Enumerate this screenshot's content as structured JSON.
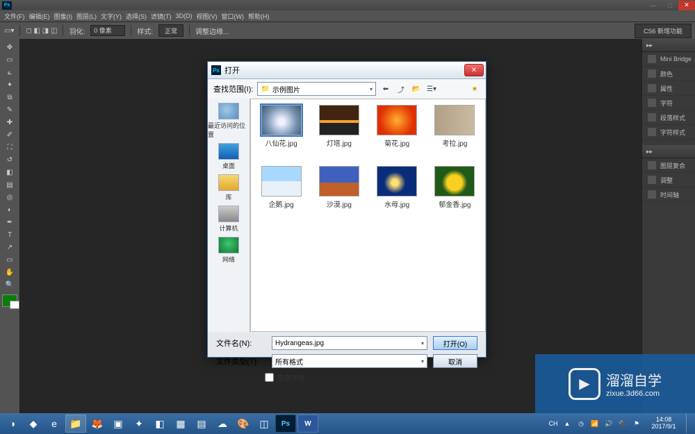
{
  "menu": {
    "file": "文件(F)",
    "edit": "编辑(E)",
    "image": "图像(I)",
    "layer": "图层(L)",
    "type": "文字(Y)",
    "select": "选择(S)",
    "filter": "滤镜(T)",
    "view3d": "3D(D)",
    "view": "视图(V)",
    "window": "窗口(W)",
    "help": "帮助(H)"
  },
  "options": {
    "feather_lbl": "羽化:",
    "feather_val": "0 像素",
    "style_lbl": "样式:",
    "style_val": "正常",
    "adjust_lbl": "调整边缘...",
    "workspace": "CS6 新增功能"
  },
  "panels": {
    "mini": "Mini Bridge",
    "color": "颜色",
    "props": "属性",
    "char": "字符",
    "para": "段落样式",
    "cstyle": "字符样式",
    "layerc": "图层复合",
    "adjust": "调整",
    "history": "时间轴"
  },
  "right_head": {
    "a": "▸▸",
    "b": "▸▸"
  },
  "dialog": {
    "title": "打开",
    "lookin_lbl": "查找范围(I):",
    "lookin_val": "示例图片",
    "nav": {
      "recent": "最近访问的位置",
      "desktop": "桌面",
      "lib": "库",
      "pc": "计算机",
      "net": "网络"
    },
    "files": [
      {
        "name": "八仙花.jpg",
        "sel": true
      },
      {
        "name": "灯塔.jpg"
      },
      {
        "name": "菊花.jpg"
      },
      {
        "name": "考拉.jpg"
      },
      {
        "name": "企鹅.jpg"
      },
      {
        "name": "沙漠.jpg"
      },
      {
        "name": "水母.jpg"
      },
      {
        "name": "郁金香.jpg"
      }
    ],
    "filename_lbl": "文件名(N):",
    "filename_val": "Hydrangeas.jpg",
    "filetype_lbl": "文件类型(T):",
    "filetype_val": "所有格式",
    "open_btn": "打开(O)",
    "cancel_btn": "取消",
    "seq_chk": "图像序列"
  },
  "tray": {
    "time": "14:08",
    "date": "2017/9/1",
    "ime": "CH"
  },
  "watermark": {
    "brand": "溜溜自学",
    "site": "zixue.3d66.com"
  }
}
